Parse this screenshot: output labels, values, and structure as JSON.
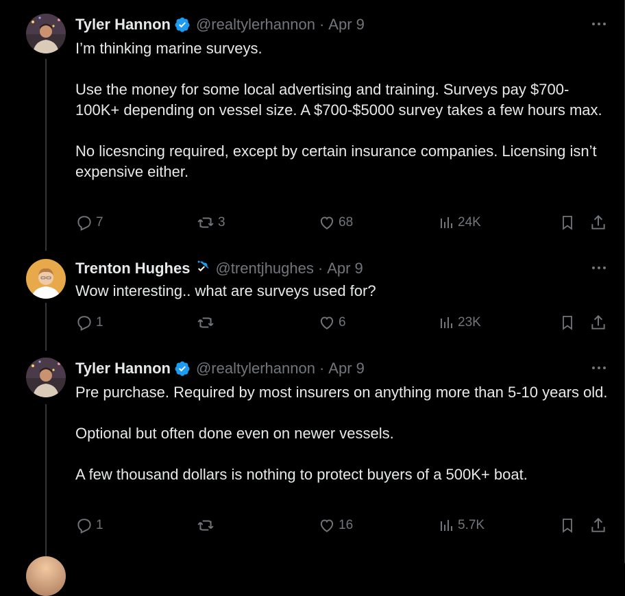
{
  "tweets": [
    {
      "name": "Tyler Hannon",
      "handle": "@realtylerhannon",
      "date": "Apr 9",
      "paragraphs": [
        "I’m thinking marine surveys.",
        "Use the money for some local advertising and training. Surveys pay $700-100K+ depending on vessel size. A $700-$5000 survey takes a few hours max.",
        "No licesncing required, except by certain insurance companies. Licensing isn’t expensive either."
      ],
      "replies": "7",
      "reposts": "3",
      "likes": "68",
      "views": "24K"
    },
    {
      "name": "Trenton Hughes",
      "handle": "@trentjhughes",
      "date": "Apr 9",
      "paragraphs": [
        "Wow interesting.. what are surveys used for?"
      ],
      "replies": "1",
      "reposts": "",
      "likes": "6",
      "views": "23K"
    },
    {
      "name": "Tyler Hannon",
      "handle": "@realtylerhannon",
      "date": "Apr 9",
      "paragraphs": [
        "Pre purchase. Required by most insurers on anything more than 5-10 years old.",
        "Optional but often done even on newer vessels.",
        "A few thousand dollars is nothing to protect buyers of a 500K+ boat."
      ],
      "replies": "1",
      "reposts": "",
      "likes": "16",
      "views": "5.7K"
    }
  ],
  "separator": "·",
  "colors": {
    "background": "#000000",
    "text": "#e7e9ea",
    "muted": "#71767b",
    "verified": "#1d9bf0",
    "thread_line": "#333639"
  },
  "icons": [
    "verified-badge-icon",
    "more-icon",
    "reply-icon",
    "repost-icon",
    "like-icon",
    "views-icon",
    "bookmark-icon",
    "share-icon"
  ]
}
